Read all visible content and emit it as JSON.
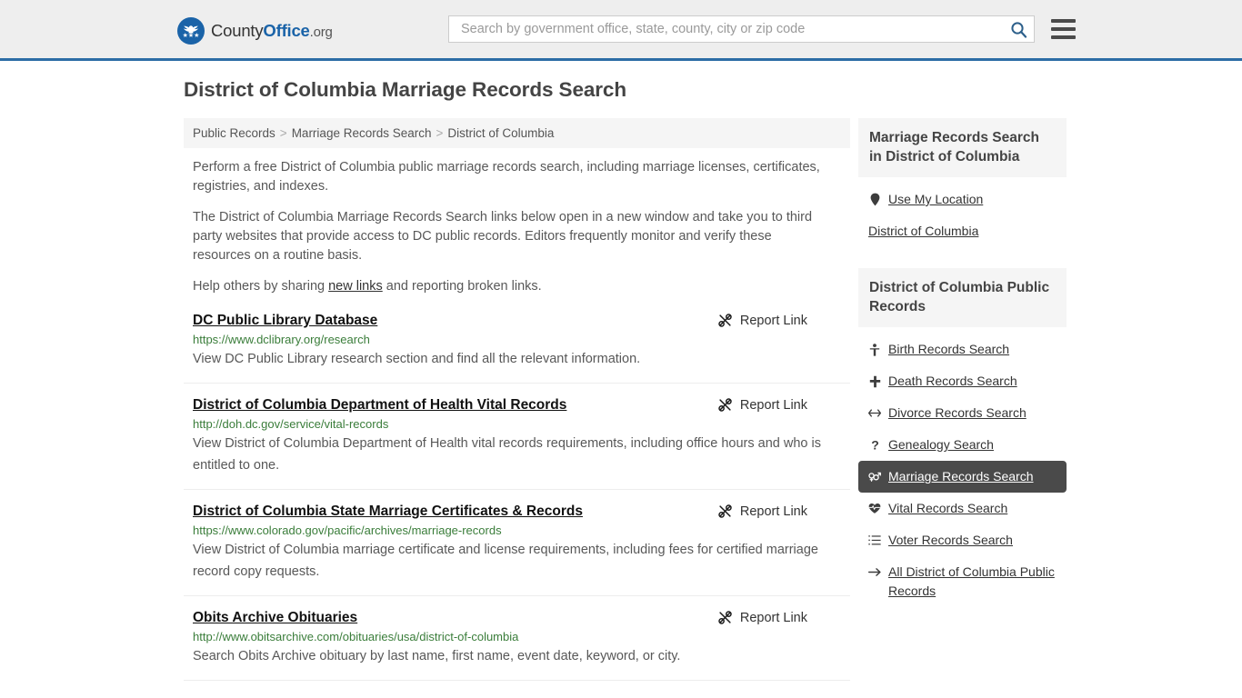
{
  "header": {
    "logo": {
      "text_part1": "County",
      "text_part2": "Office",
      "text_part3": ".org",
      "icon": "eagle-seal-icon"
    },
    "search": {
      "placeholder": "Search by government office, state, county, city or zip code",
      "value": "",
      "search_icon": "search-icon"
    },
    "menu_icon": "hamburger-menu-icon",
    "background_color": "#eeeeee",
    "border_color": "#2c6ca5",
    "accent_color": "#1a63a8"
  },
  "page_title": "District of Columbia Marriage Records Search",
  "breadcrumb": {
    "items": [
      {
        "label": "Public Records"
      },
      {
        "label": "Marriage Records Search"
      },
      {
        "label": "District of Columbia"
      }
    ],
    "separator": ">"
  },
  "intro": {
    "paragraph1": "Perform a free District of Columbia public marriage records search, including marriage licenses, certificates, registries, and indexes.",
    "paragraph2": "The District of Columbia Marriage Records Search links below open in a new window and take you to third party websites that provide access to DC public records. Editors frequently monitor and verify these resources on a routine basis.",
    "paragraph3_before": "Help others by sharing ",
    "paragraph3_link": "new links",
    "paragraph3_after": " and reporting broken links."
  },
  "results": {
    "report_label": "Report Link",
    "report_icon": "broken-link-icon",
    "items": [
      {
        "title": "DC Public Library Database",
        "url": "https://www.dclibrary.org/research",
        "description": "View DC Public Library research section and find all the relevant information."
      },
      {
        "title": "District of Columbia Department of Health Vital Records",
        "url": "http://doh.dc.gov/service/vital-records",
        "description": "View District of Columbia Department of Health vital records requirements, including office hours and who is entitled to one."
      },
      {
        "title": "District of Columbia State Marriage Certificates & Records",
        "url": "https://www.colorado.gov/pacific/archives/marriage-records",
        "description": "View District of Columbia marriage certificate and license requirements, including fees for certified marriage record copy requests."
      },
      {
        "title": "Obits Archive Obituaries",
        "url": "http://www.obitsarchive.com/obituaries/usa/district-of-columbia",
        "description": "Search Obits Archive obituary by last name, first name, event date, keyword, or city."
      }
    ]
  },
  "sidebar": {
    "panel1": {
      "heading": "Marriage Records Search in District of Columbia",
      "items": [
        {
          "label": "Use My Location",
          "icon": "map-pin-icon",
          "has_icon": true
        },
        {
          "label": "District of Columbia",
          "icon": "",
          "has_icon": false
        }
      ]
    },
    "panel2": {
      "heading": "District of Columbia Public Records",
      "active_color": "#4a4a4a",
      "items": [
        {
          "label": "Birth Records Search",
          "icon": "baby-icon",
          "active": false
        },
        {
          "label": "Death Records Search",
          "icon": "cross-icon",
          "active": false
        },
        {
          "label": "Divorce Records Search",
          "icon": "arrows-split-icon",
          "active": false
        },
        {
          "label": "Genealogy Search",
          "icon": "question-mark-icon",
          "active": false
        },
        {
          "label": "Marriage Records Search",
          "icon": "gender-symbols-icon",
          "active": true
        },
        {
          "label": "Vital Records Search",
          "icon": "heartbeat-icon",
          "active": false
        },
        {
          "label": "Voter Records Search",
          "icon": "ordered-list-icon",
          "active": false
        },
        {
          "label": "All District of Columbia Public Records",
          "icon": "arrow-right-icon",
          "active": false
        }
      ]
    }
  }
}
